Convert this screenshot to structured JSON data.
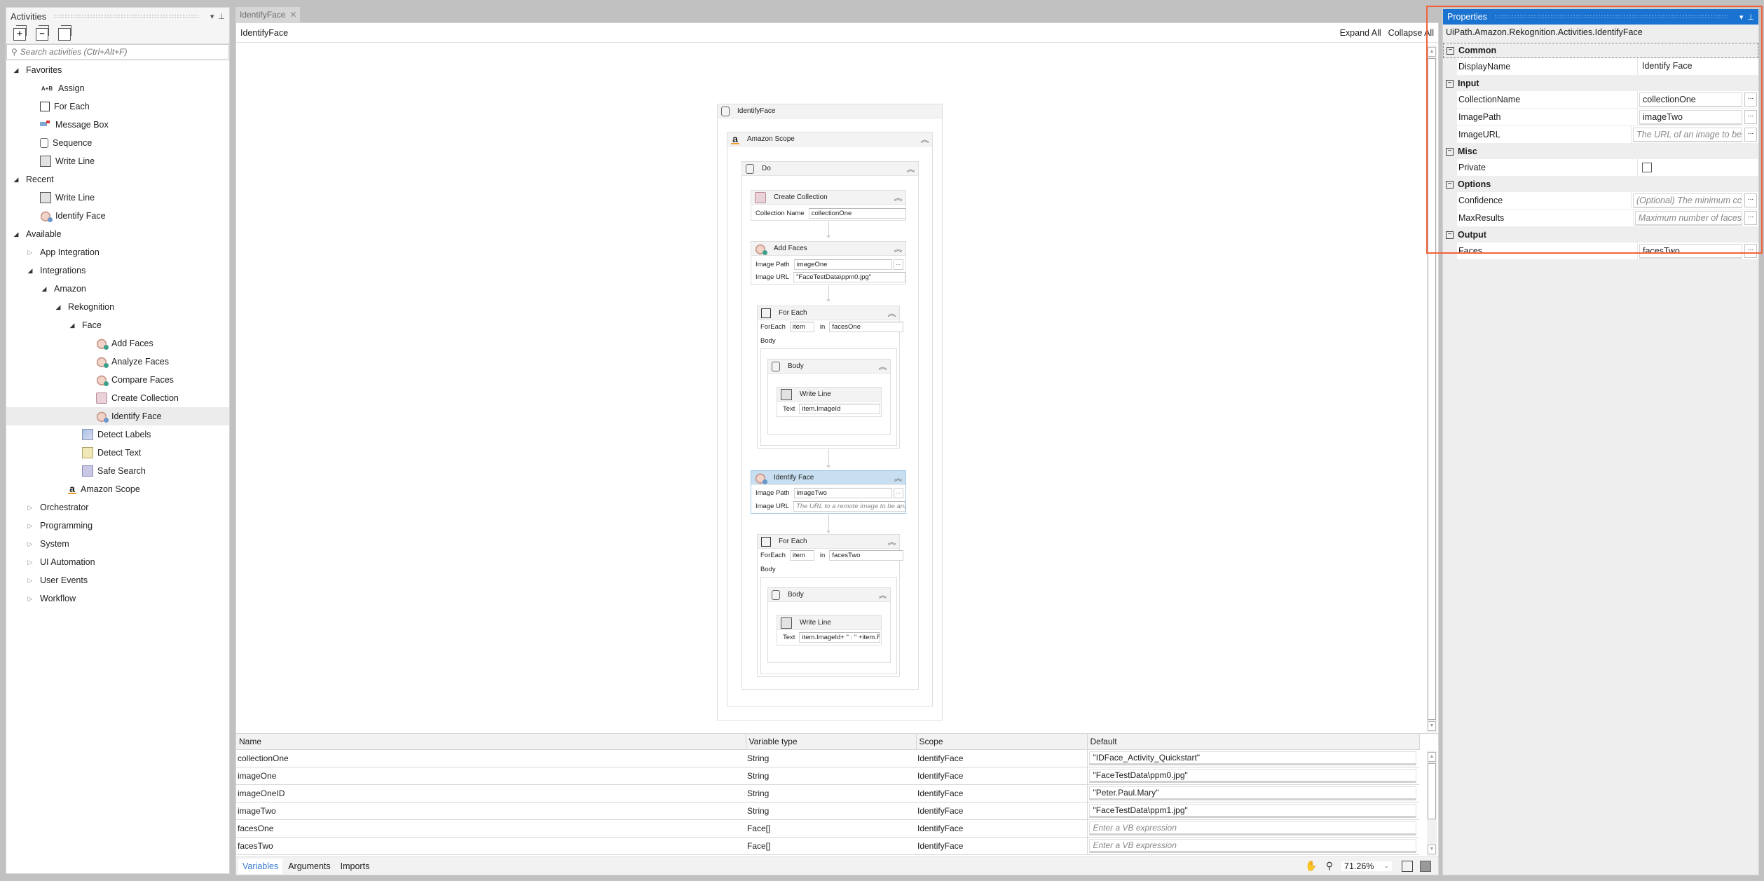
{
  "activities": {
    "title": "Activities",
    "search_placeholder": "Search activities (Ctrl+Alt+F)",
    "tree": [
      {
        "label": "Favorites",
        "level": 0,
        "expander": "open"
      },
      {
        "label": "Assign",
        "level": 2,
        "icon": "assign-icon"
      },
      {
        "label": "For Each",
        "level": 2,
        "icon": "for-each-icon"
      },
      {
        "label": "Message Box",
        "level": 2,
        "icon": "message-box-icon"
      },
      {
        "label": "Sequence",
        "level": 2,
        "icon": "sequence-icon"
      },
      {
        "label": "Write Line",
        "level": 2,
        "icon": "write-line-icon"
      },
      {
        "label": "Recent",
        "level": 0,
        "expander": "open"
      },
      {
        "label": "Write Line",
        "level": 2,
        "icon": "write-line-icon"
      },
      {
        "label": "Identify Face",
        "level": 2,
        "icon": "identify-face-icon"
      },
      {
        "label": "Available",
        "level": 0,
        "expander": "open"
      },
      {
        "label": "App Integration",
        "level": 1,
        "expander": "closed"
      },
      {
        "label": "Integrations",
        "level": 1,
        "expander": "open"
      },
      {
        "label": "Amazon",
        "level": 2,
        "expander": "open"
      },
      {
        "label": "Rekognition",
        "level": 3,
        "expander": "open"
      },
      {
        "label": "Face",
        "level": 4,
        "expander": "open"
      },
      {
        "label": "Add Faces",
        "level": 6,
        "icon": "add-faces-icon"
      },
      {
        "label": "Analyze Faces",
        "level": 6,
        "icon": "analyze-faces-icon"
      },
      {
        "label": "Compare Faces",
        "level": 6,
        "icon": "compare-faces-icon"
      },
      {
        "label": "Create Collection",
        "level": 6,
        "icon": "create-collection-icon"
      },
      {
        "label": "Identify Face",
        "level": 6,
        "icon": "identify-face-icon",
        "selected": true
      },
      {
        "label": "Detect Labels",
        "level": 5,
        "icon": "detect-labels-icon"
      },
      {
        "label": "Detect Text",
        "level": 5,
        "icon": "detect-text-icon"
      },
      {
        "label": "Safe Search",
        "level": 5,
        "icon": "safe-search-icon"
      },
      {
        "label": "Amazon Scope",
        "level": 4,
        "icon": "amazon-scope-icon"
      },
      {
        "label": "Orchestrator",
        "level": 1,
        "expander": "closed"
      },
      {
        "label": "Programming",
        "level": 1,
        "expander": "closed"
      },
      {
        "label": "System",
        "level": 1,
        "expander": "closed"
      },
      {
        "label": "UI Automation",
        "level": 1,
        "expander": "closed"
      },
      {
        "label": "User Events",
        "level": 1,
        "expander": "closed"
      },
      {
        "label": "Workflow",
        "level": 1,
        "expander": "closed"
      }
    ]
  },
  "document": {
    "tab_label": "IdentifyFace",
    "breadcrumb": "IdentifyFace",
    "expand_all": "Expand All",
    "collapse_all": "Collapse All"
  },
  "workflow": {
    "root": "IdentifyFace",
    "scope": "Amazon Scope",
    "do": "Do",
    "create_collection": {
      "title": "Create Collection",
      "label": "Collection Name",
      "value": "collectionOne"
    },
    "add_faces": {
      "title": "Add Faces",
      "path_label": "Image Path",
      "path_value": "imageOne",
      "url_label": "Image URL",
      "url_value": "\"FaceTestData\\ppm0.jpg\""
    },
    "for_each_1": {
      "title": "For Each",
      "foreach_label": "ForEach",
      "item": "item",
      "in_label": "in",
      "collection": "facesOne",
      "body_label": "Body",
      "body_title": "Body",
      "write_line": "Write Line",
      "text_label": "Text",
      "text_value": "item.ImageId"
    },
    "identify_face": {
      "title": "Identify Face",
      "path_label": "Image Path",
      "path_value": "imageTwo",
      "url_label": "Image URL",
      "url_placeholder": "The URL to a remote image to be analysed"
    },
    "for_each_2": {
      "title": "For Each",
      "foreach_label": "ForEach",
      "item": "item",
      "in_label": "in",
      "collection": "facesTwo",
      "body_label": "Body",
      "body_title": "Body",
      "write_line": "Write Line",
      "text_label": "Text",
      "text_value": "item.ImageId+ \" : \" +item.Fac"
    },
    "ellipsis": "..."
  },
  "variables": {
    "headers": [
      "Name",
      "Variable type",
      "Scope",
      "Default"
    ],
    "rows": [
      {
        "name": "collectionOne",
        "type": "String",
        "scope": "IdentifyFace",
        "default": "\"IDFace_Activity_Quickstart\"",
        "placeholder": false
      },
      {
        "name": "imageOne",
        "type": "String",
        "scope": "IdentifyFace",
        "default": "\"FaceTestData\\ppm0.jpg\"",
        "placeholder": false
      },
      {
        "name": "imageOneID",
        "type": "String",
        "scope": "IdentifyFace",
        "default": "\"Peter.Paul.Mary\"",
        "placeholder": false
      },
      {
        "name": "imageTwo",
        "type": "String",
        "scope": "IdentifyFace",
        "default": "\"FaceTestData\\ppm1.jpg\"",
        "placeholder": false
      },
      {
        "name": "facesOne",
        "type": "Face[]",
        "scope": "IdentifyFace",
        "default": "Enter a VB expression",
        "placeholder": true
      },
      {
        "name": "facesTwo",
        "type": "Face[]",
        "scope": "IdentifyFace",
        "default": "Enter a VB expression",
        "placeholder": true
      }
    ],
    "tabs": [
      "Variables",
      "Arguments",
      "Imports"
    ],
    "active_tab": "Variables",
    "zoom": "71.26%"
  },
  "properties": {
    "title": "Properties",
    "type_name": "UiPath.Amazon.Rekognition.Activities.IdentifyFace",
    "categories": [
      {
        "name": "Common",
        "props": [
          {
            "name": "DisplayName",
            "value": "Identify Face",
            "kind": "plain"
          }
        ]
      },
      {
        "name": "Input",
        "props": [
          {
            "name": "CollectionName",
            "value": "collectionOne",
            "kind": "expr"
          },
          {
            "name": "ImagePath",
            "value": "imageTwo",
            "kind": "expr"
          },
          {
            "name": "ImageURL",
            "value": "The URL of an image to be",
            "kind": "placeholder"
          }
        ]
      },
      {
        "name": "Misc",
        "props": [
          {
            "name": "Private",
            "value": false,
            "kind": "checkbox"
          }
        ]
      },
      {
        "name": "Options",
        "props": [
          {
            "name": "Confidence",
            "value": "(Optional) The minimum cc",
            "kind": "placeholder"
          },
          {
            "name": "MaxResults",
            "value": "Maximum number of faces",
            "kind": "placeholder"
          }
        ]
      },
      {
        "name": "Output",
        "props": [
          {
            "name": "Faces",
            "value": "facesTwo",
            "kind": "expr"
          }
        ]
      }
    ],
    "ellipsis": "..."
  },
  "colors": {
    "accent": "#1a73d1",
    "highlight_outline": "#f0643c",
    "selected_activity": "#c7dff0"
  }
}
